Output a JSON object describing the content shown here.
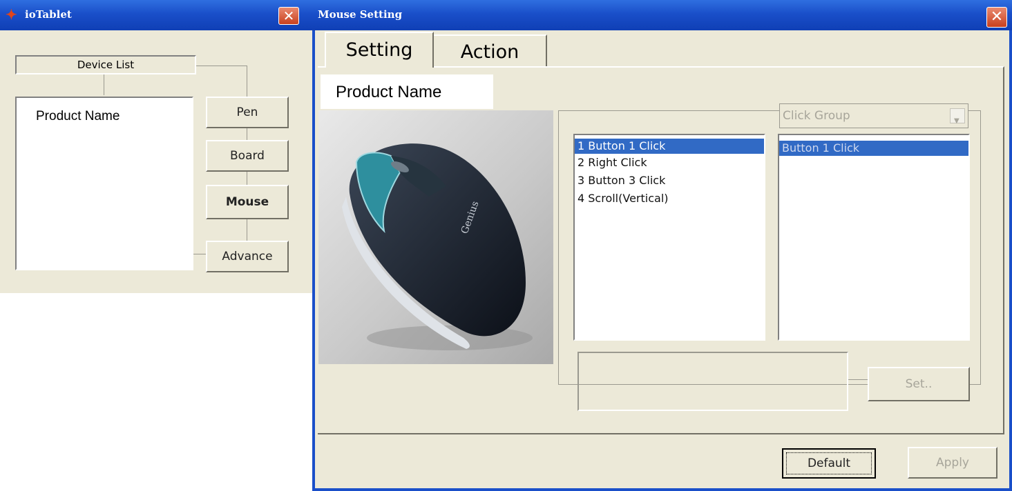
{
  "left_window": {
    "title": "ioTablet",
    "device_list_label": "Device List",
    "product_name": "Product Name",
    "nav_buttons": [
      "Pen",
      "Board",
      "Mouse",
      "Advance"
    ]
  },
  "mouse_window": {
    "title": "Mouse Setting",
    "tabs": [
      "Setting",
      "Action"
    ],
    "product_name": "Product Name",
    "button_list": [
      "1  Button 1 Click",
      "2  Right Click",
      "3  Button 3 Click",
      "4  Scroll(Vertical)"
    ],
    "click_group_select": "Click Group",
    "action_list": [
      "Button 1 Click"
    ],
    "set_button": "Set..",
    "default_button": "Default",
    "apply_button": "Apply",
    "image_brand_text": "Genius"
  },
  "colors": {
    "titlebar": "#1a4fc9",
    "dialog_bg": "#ece9d8",
    "selection": "#316ac5"
  }
}
